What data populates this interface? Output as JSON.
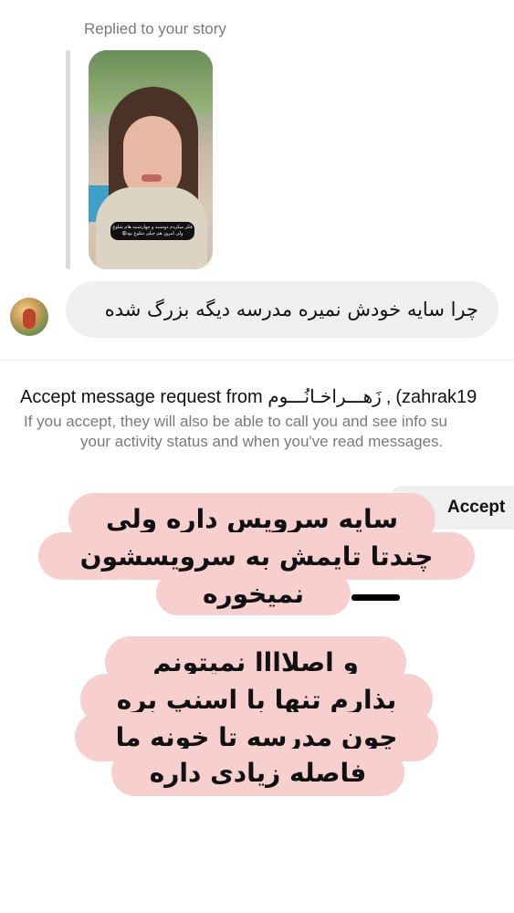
{
  "story_reply": {
    "header": "Replied to your story",
    "story_caption": "فکر میکردم دوشنبه و چهارشنبه هام شلوغ ولی امروز هم خیلی شلوغ بود😩"
  },
  "message": {
    "text": "چرا سایه خودش نمیره مدرسه دیگه بزرگ شده"
  },
  "request": {
    "title": "Accept message request from زَهـــراخـانُـــوم ‚ (zahrak19",
    "subtitle_line1": "If you accept, they will also be able to call you and see info su",
    "subtitle_line2": "your activity status and when you've read messages.",
    "accept_label": "Accept"
  },
  "overlay_text": {
    "block1": [
      "سایه سرویس داره ولی",
      "چندتا تایمش به سرویسشون",
      "نمیخوره"
    ],
    "block2": [
      "و اصلاااا نمیتونم",
      "بذارم تنها با اسنپ بره",
      "چون مدرسه تا خونه ما",
      "فاصله زیادی داره"
    ]
  },
  "colors": {
    "overlay_pill": "#f7cfcf",
    "bubble": "#efefef",
    "secondary_text": "#7a7a7a"
  }
}
